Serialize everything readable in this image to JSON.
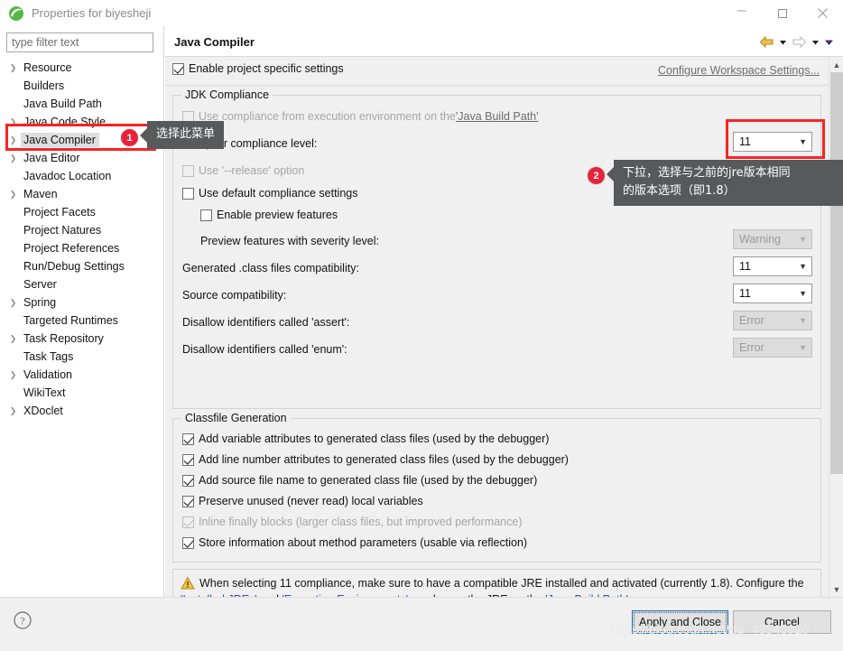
{
  "window": {
    "title": "Properties for biyesheji",
    "icon": "eclipse-icon",
    "minimize": "minimize-icon",
    "maximize": "maximize-icon",
    "close": "close-icon"
  },
  "sidebar": {
    "filter_placeholder": "type filter text",
    "filter_value": "",
    "items": [
      {
        "label": "Resource",
        "expandable": true,
        "selected": false
      },
      {
        "label": "Builders",
        "expandable": false,
        "selected": false
      },
      {
        "label": "Java Build Path",
        "expandable": false,
        "selected": false
      },
      {
        "label": "Java Code Style",
        "expandable": true,
        "selected": false
      },
      {
        "label": "Java Compiler",
        "expandable": true,
        "selected": true
      },
      {
        "label": "Java Editor",
        "expandable": true,
        "selected": false
      },
      {
        "label": "Javadoc Location",
        "expandable": false,
        "selected": false
      },
      {
        "label": "Maven",
        "expandable": true,
        "selected": false
      },
      {
        "label": "Project Facets",
        "expandable": false,
        "selected": false
      },
      {
        "label": "Project Natures",
        "expandable": false,
        "selected": false
      },
      {
        "label": "Project References",
        "expandable": false,
        "selected": false
      },
      {
        "label": "Run/Debug Settings",
        "expandable": false,
        "selected": false
      },
      {
        "label": "Server",
        "expandable": false,
        "selected": false
      },
      {
        "label": "Spring",
        "expandable": true,
        "selected": false
      },
      {
        "label": "Targeted Runtimes",
        "expandable": false,
        "selected": false
      },
      {
        "label": "Task Repository",
        "expandable": true,
        "selected": false
      },
      {
        "label": "Task Tags",
        "expandable": false,
        "selected": false
      },
      {
        "label": "Validation",
        "expandable": true,
        "selected": false
      },
      {
        "label": "WikiText",
        "expandable": false,
        "selected": false
      },
      {
        "label": "XDoclet",
        "expandable": true,
        "selected": false
      }
    ]
  },
  "page": {
    "title": "Java Compiler",
    "nav_back": "back-arrow-icon",
    "nav_forward": "forward-arrow-icon",
    "nav_menu": "dropdown-caret-icon",
    "enable_project_specific": {
      "label": "Enable project specific settings",
      "checked": true
    },
    "configure_workspace_link": "Configure Workspace Settings..."
  },
  "jdk_compliance": {
    "group_title": "JDK Compliance",
    "use_compliance_from_ee": {
      "label_prefix": "Use compliance from execution environment on the ",
      "link": "'Java Build Path'",
      "checked": false,
      "enabled": false
    },
    "compiler_compliance_level": {
      "label": "Compiler compliance level:",
      "value": "11",
      "enabled": true
    },
    "use_release_option": {
      "label": "Use '--release' option",
      "checked": false,
      "enabled": false
    },
    "use_default_compliance_settings": {
      "label": "Use default compliance settings",
      "checked": false,
      "enabled": true
    },
    "enable_preview_features": {
      "label": "Enable preview features",
      "checked": false,
      "enabled": true
    },
    "rows": [
      {
        "label": "Preview features with severity level:",
        "value": "Warning",
        "enabled": false,
        "indent": 20
      },
      {
        "label": "Generated .class files compatibility:",
        "value": "11",
        "enabled": true,
        "indent": 0
      },
      {
        "label": "Source compatibility:",
        "value": "11",
        "enabled": true,
        "indent": 0
      },
      {
        "label": "Disallow identifiers called 'assert':",
        "value": "Error",
        "enabled": false,
        "indent": 0
      },
      {
        "label": "Disallow identifiers called 'enum':",
        "value": "Error",
        "enabled": false,
        "indent": 0
      }
    ]
  },
  "classfile_generation": {
    "group_title": "Classfile Generation",
    "options": [
      {
        "label": "Add variable attributes to generated class files (used by the debugger)",
        "checked": true,
        "enabled": true
      },
      {
        "label": "Add line number attributes to generated class files (used by the debugger)",
        "checked": true,
        "enabled": true
      },
      {
        "label": "Add source file name to generated class file (used by the debugger)",
        "checked": true,
        "enabled": true
      },
      {
        "label": "Preserve unused (never read) local variables",
        "checked": true,
        "enabled": true
      },
      {
        "label": "Inline finally blocks (larger class files, but improved performance)",
        "checked": true,
        "enabled": false
      },
      {
        "label": "Store information about method parameters (usable via reflection)",
        "checked": true,
        "enabled": true
      }
    ]
  },
  "warning": {
    "icon": "warning-triangle-icon",
    "text_1": "When selecting 11 compliance, make sure to have a compatible JRE installed and activated (currently 1.8). Configure the ",
    "link_1": "'Installed JREs'",
    "text_2": " and ",
    "link_2": "'Execution Environments'",
    "text_3": ", or change the JRE on the ",
    "link_3": "'Java Build Path'",
    "text_4": "."
  },
  "footer": {
    "help_icon": "help-question-icon",
    "apply_and_close": "Apply and Close",
    "cancel": "Cancel"
  },
  "annotations": {
    "badge_1": "1",
    "callout_1": "选择此菜单",
    "badge_2": "2",
    "callout_2": "下拉，选择与之前的jre版本相同\n的版本选项（即1.8）",
    "highlight_color": "#fb2222"
  },
  "watermark": "https://blog.csdn.net/qq_43543920"
}
